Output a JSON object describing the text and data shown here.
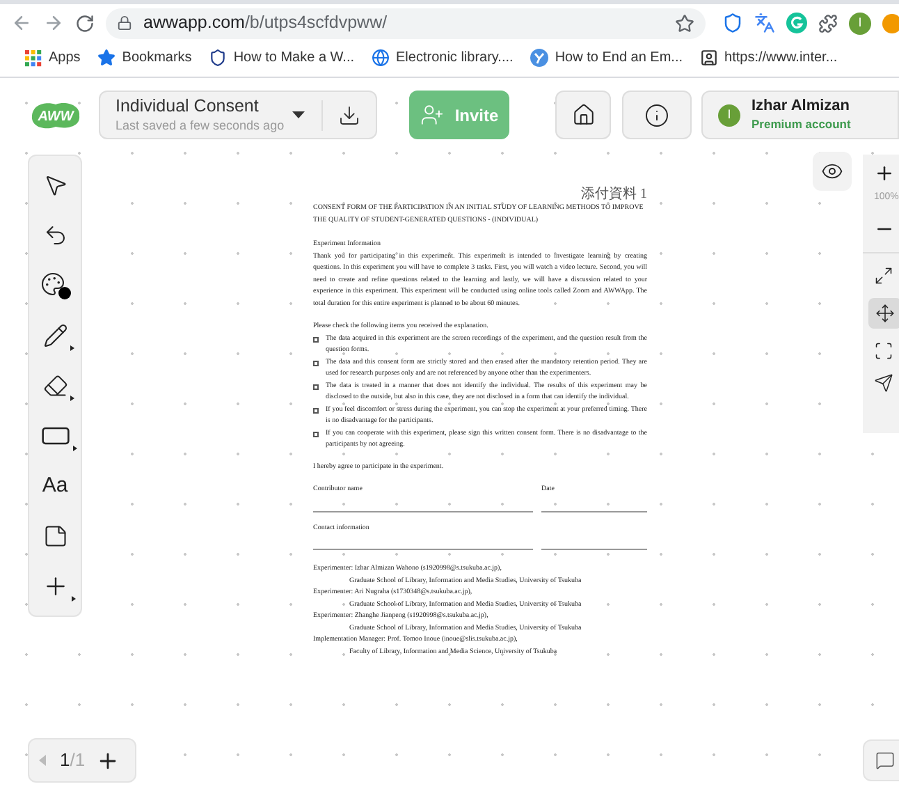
{
  "browser": {
    "url_host": "awwapp.com",
    "url_path": "/b/utps4scfdvpww/",
    "profile_initial": "I",
    "bookmarks": [
      {
        "label": "Apps"
      },
      {
        "label": "Bookmarks"
      },
      {
        "label": "How to Make a W..."
      },
      {
        "label": "Electronic library...."
      },
      {
        "label": "How to End an Em..."
      },
      {
        "label": "https://www.inter..."
      }
    ]
  },
  "header": {
    "logo": "AWW",
    "board_title": "Individual Consent",
    "saved_status": "Last saved a few seconds ago",
    "invite_label": "Invite",
    "user_initial": "I",
    "user_name": "Izhar Almizan",
    "user_plan": "Premium account"
  },
  "toolbar": [
    {
      "kind": "select",
      "has_menu": false
    },
    {
      "kind": "undo",
      "has_menu": false
    },
    {
      "kind": "palette",
      "has_menu": false
    },
    {
      "kind": "pencil",
      "has_menu": true
    },
    {
      "kind": "eraser",
      "has_menu": true
    },
    {
      "kind": "rectangle",
      "has_menu": true
    },
    {
      "kind": "text",
      "label": "Aa",
      "has_menu": false
    },
    {
      "kind": "note",
      "has_menu": false
    },
    {
      "kind": "add",
      "has_menu": true
    }
  ],
  "zoom": {
    "reading": "100%"
  },
  "pages": {
    "current": "1",
    "total": "/1"
  },
  "document": {
    "page_mark": "添付資料 1",
    "title": "CONSENT FORM OF THE PARTICIPATION IN AN INITIAL STUDY OF LEARNING METHODS TO IMPROVE THE QUALITY OF STUDENT-GENERATED QUESTIONS - (INDIVIDUAL)",
    "section": "Experiment Information",
    "intro": "Thank you for participating in this experiment. This experiment is intended to investigate learning by creating questions. In this experiment you will have to complete 3 tasks. First, you will watch a video lecture. Second, you will need to create and refine questions related to the learning and lastly, we will have a discussion related to your experience in this experiment. This experiment will be conducted using online tools called Zoom and AWWApp. The total duration for this entire experiment is planned to be about 60 minutes.",
    "check_prompt": "Please check the following items you received the explanation.",
    "items": [
      {
        "text": "The data acquired in this experiment are the screen recordings of the experiment, and the question result from the question forms.",
        "checked": false
      },
      {
        "text": "The data and this consent form are strictly stored and then erased after the mandatory retention period. They are used for research purposes only and are not referenced by anyone other than the experimenters.",
        "checked": false
      },
      {
        "text": "The data is treated in a manner that does not identify the individual. The results of this experiment may be disclosed to the outside, but also in this case, they are not disclosed in a form that can identify the individual.",
        "checked": false
      },
      {
        "text": "If you feel discomfort or stress during the experiment, you can stop the experiment at your preferred timing. There is no disadvantage for the participants.",
        "checked": false
      },
      {
        "text": "If you can cooperate with this experiment, please sign this written consent form. There is no disadvantage to the participants by not agreeing.",
        "checked": false
      }
    ],
    "agree": "I hereby agree to participate in the experiment.",
    "fields": [
      {
        "label": "Contributor name",
        "side": "Date"
      },
      {
        "label": "Contact information"
      }
    ],
    "contacts": [
      {
        "role": "Experimenter: Izhar Almizan Wahono (s1920998@s.tsukuba.ac.jp),",
        "affiliation": "Graduate School of Library, Information and Media Studies, University of Tsukuba"
      },
      {
        "role": "Experimenter: Ari Nugraha (s1730348@s.tsukuba.ac.jp),",
        "affiliation": "Graduate School of Library, Information and Media Studies, University of Tsukuba"
      },
      {
        "role": "Experimenter: Zhanghe Jianpeng (s1920998@s.tsukuba.ac.jp),",
        "affiliation": "Graduate School of Library, Information and Media Studies, University of Tsukuba"
      },
      {
        "role": "Implementation Manager: Prof. Tomoo Inoue (inoue@slis.tsukuba.ac.jp),",
        "affiliation": "Faculty of Library, Information and Media Science, University of Tsukuba"
      }
    ]
  }
}
